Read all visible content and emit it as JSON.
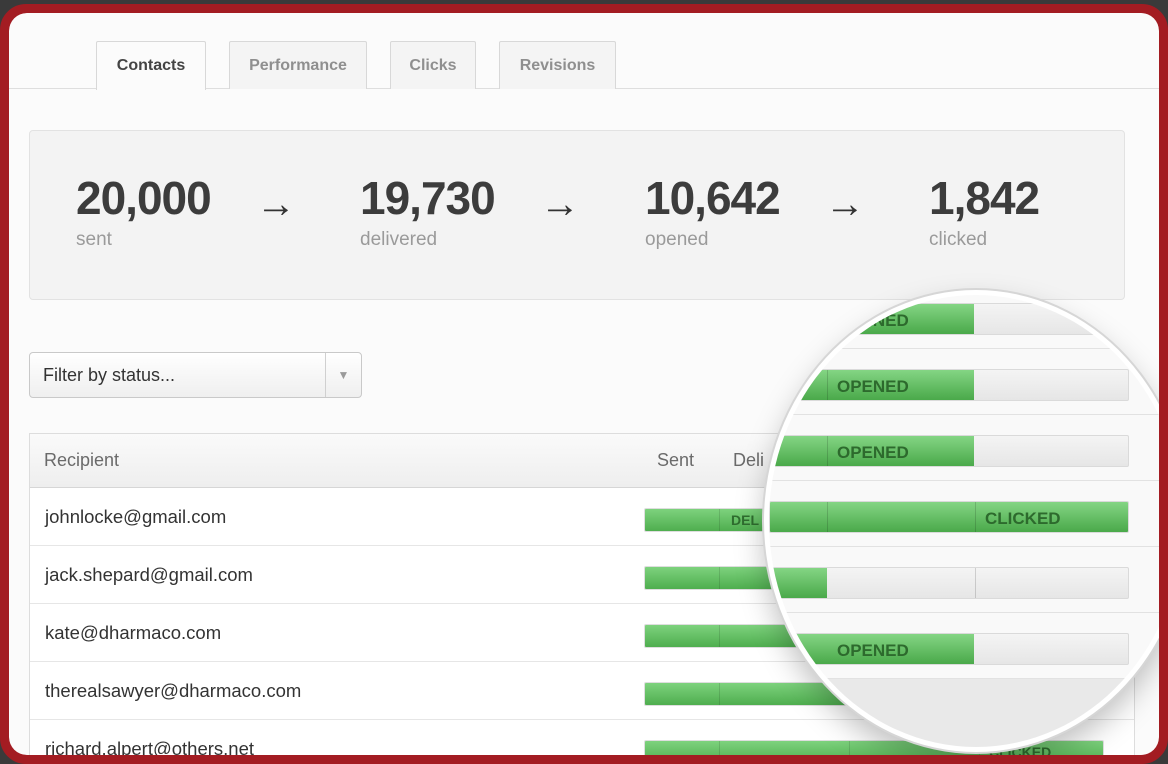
{
  "tabs": [
    "Contacts",
    "Performance",
    "Clicks",
    "Revisions"
  ],
  "stats": [
    {
      "value": "20,000",
      "label": "sent"
    },
    {
      "value": "19,730",
      "label": "delivered"
    },
    {
      "value": "10,642",
      "label": "opened"
    },
    {
      "value": "1,842",
      "label": "clicked"
    }
  ],
  "arrow": "→",
  "filter": {
    "label": "Filter by status...",
    "caret": "▼"
  },
  "table": {
    "headers": {
      "recipient": "Recipient",
      "sent": "Sent",
      "delivered": "Deli"
    },
    "rows": [
      {
        "email": "johnlocke@gmail.com",
        "status": "DEL"
      },
      {
        "email": "jack.shepard@gmail.com",
        "status": ""
      },
      {
        "email": "kate@dharmaco.com",
        "status": ""
      },
      {
        "email": "therealsawyer@dharmaco.com",
        "status": ""
      },
      {
        "email": "richard.alpert@others.net",
        "status": "CLICKED"
      }
    ]
  },
  "magnifier": {
    "rows": [
      {
        "status": "OPENED",
        "progress": 0.57
      },
      {
        "status": "OPENED",
        "progress": 0.57
      },
      {
        "status": "OPENED",
        "progress": 0.57
      },
      {
        "status": "CLICKED",
        "progress": 1.0
      },
      {
        "status": "",
        "progress": 0.16
      },
      {
        "status": "OPENED",
        "progress": 0.57
      }
    ]
  },
  "colors": {
    "frame": "#a31c22",
    "progress_green": "#5cb85c"
  }
}
